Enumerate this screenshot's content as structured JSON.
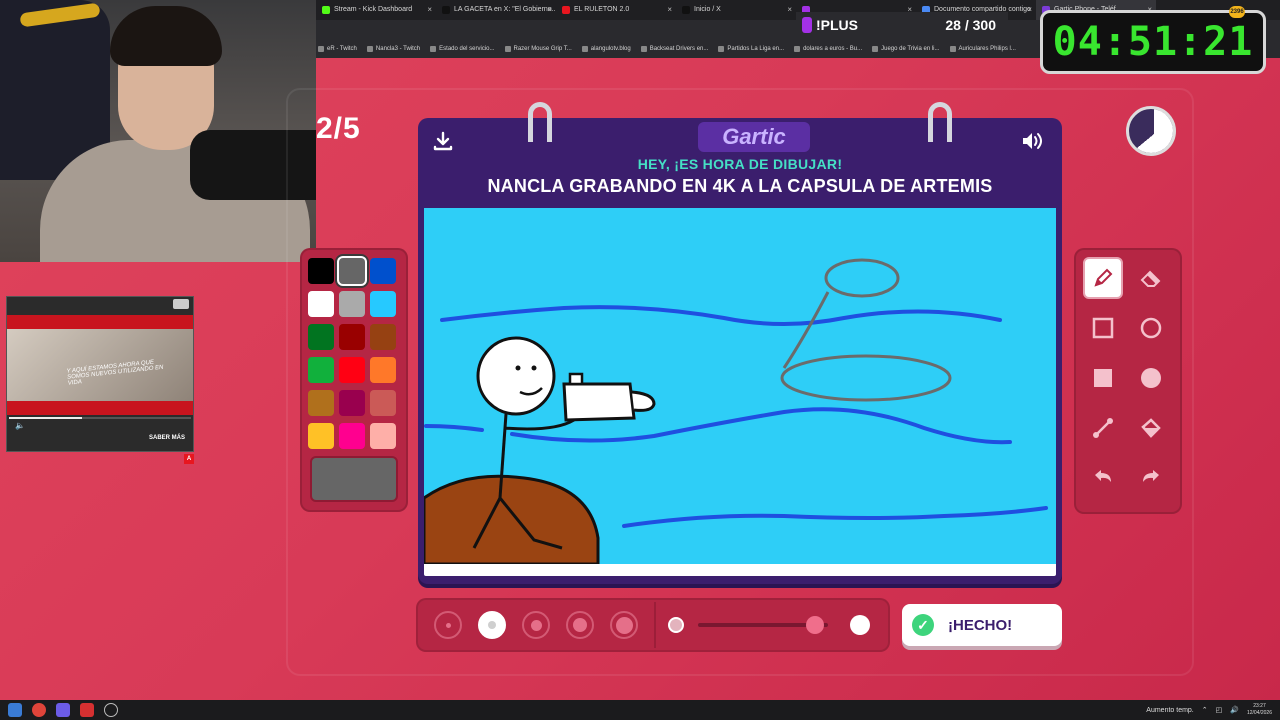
{
  "browser": {
    "tabs": [
      {
        "label": "Stream - Kick Dashboard",
        "color": "#53fc18"
      },
      {
        "label": "LA GACETA en X: \"El Gobierno...",
        "color": "#111111"
      },
      {
        "label": "EL RULETON 2.0",
        "color": "#e8161f"
      },
      {
        "label": "Inicio / X",
        "color": "#111111"
      },
      {
        "label": "",
        "color": "#a331e6"
      },
      {
        "label": "Documento compartido contigo",
        "color": "#4a89f3"
      },
      {
        "label": "Gartic Phone - Teléf...",
        "color": "#7b3bd6"
      }
    ],
    "bookmarks": [
      "eR - Twitch",
      "Nancla3 - Twitch",
      "Estado del servicio...",
      "Razer Mouse Grip T...",
      "alangulotv.blog",
      "Backseat Drivers en...",
      "Partidos La Liga en...",
      "dolares a euros - Bu...",
      "Juego de Trivia en li...",
      "Auriculares Philips l..."
    ]
  },
  "overlay": {
    "plus_label": "!PLUS",
    "sub_count": "28 / 300",
    "countdown": "04:51:21",
    "countdown_badge": "2396",
    "ad": {
      "caption": "Y aquí estamos ahora que somos nuevos utilizando en vida",
      "cta": "SABER MÁS",
      "flag": "A"
    }
  },
  "game": {
    "round": "2/5",
    "logo": "Gartic",
    "prompt_sub": "HEY, ¡ES HORA DE DIBUJAR!",
    "prompt_main": "NANCLA GRABANDO EN 4K A LA CAPSULA DE ARTEMIS",
    "timer_fraction": 0.64,
    "palette": [
      "#000000",
      "#666666",
      "#0050cd",
      "#ffffff",
      "#aaaaaa",
      "#26c9ff",
      "#017420",
      "#990000",
      "#964112",
      "#11b03c",
      "#ff0013",
      "#ff7829",
      "#b0701c",
      "#99004e",
      "#cb5a57",
      "#ffc126",
      "#ff008f",
      "#feafa8"
    ],
    "selected_color": "#666666",
    "tools": [
      "pencil-icon",
      "eraser-icon",
      "rectangle-outline-icon",
      "ellipse-outline-icon",
      "rectangle-fill-icon",
      "ellipse-fill-icon",
      "line-icon",
      "bucket-icon",
      "undo-icon",
      "redo-icon"
    ],
    "active_tool": "pencil-icon",
    "brush_sizes": [
      1,
      2,
      3,
      4,
      5
    ],
    "selected_brush": 2,
    "opacity_fraction": 0.9,
    "done_label": "¡HECHO!"
  },
  "taskbar": {
    "tray_text": "Aumento temp.",
    "time": "23:27",
    "date": "12/04/2026"
  }
}
